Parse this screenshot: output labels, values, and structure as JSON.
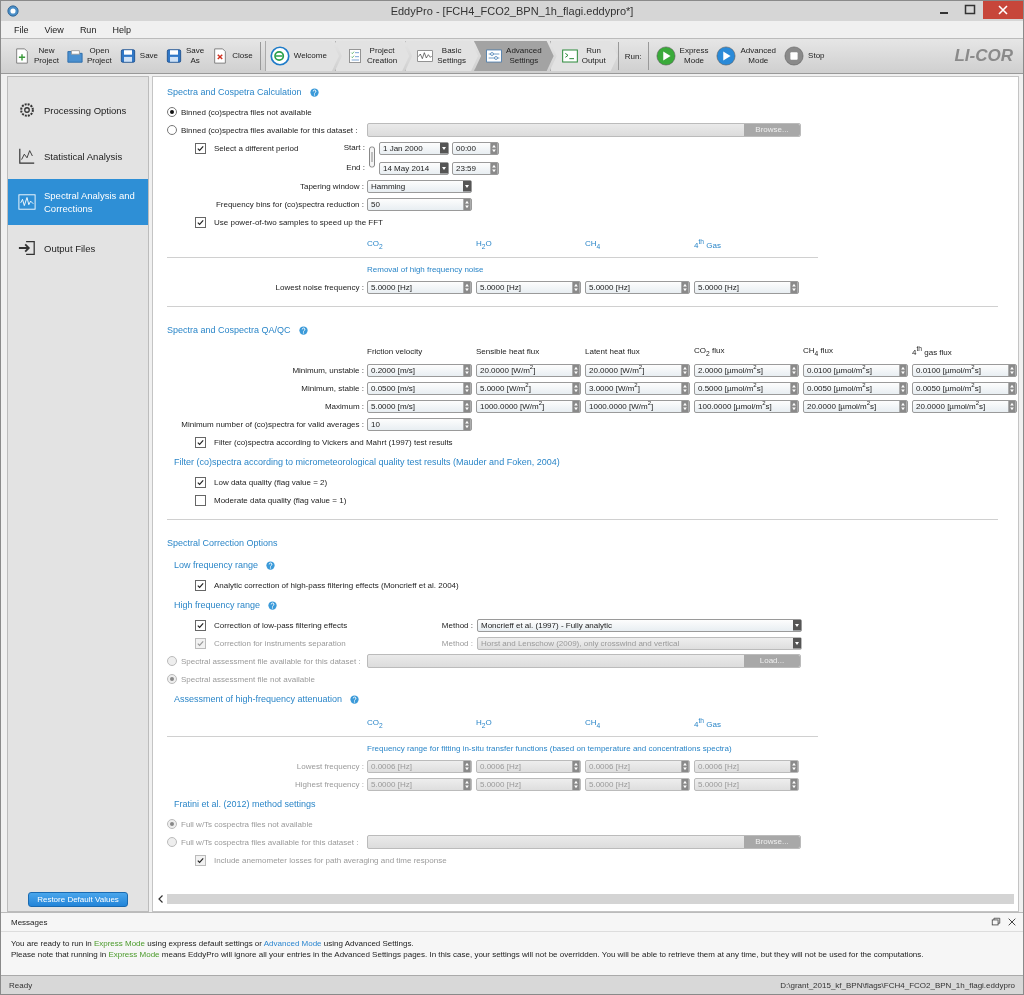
{
  "window": {
    "title": "EddyPro - [FCH4_FCO2_BPN_1h_flagi.eddypro*]"
  },
  "menu": [
    "File",
    "View",
    "Run",
    "Help"
  ],
  "toolbar": {
    "file_buttons": [
      "New Project",
      "Open Project",
      "Save",
      "Save As",
      "Close"
    ],
    "steps": [
      {
        "label": "Welcome",
        "selected": false
      },
      {
        "label": "Project Creation",
        "selected": false
      },
      {
        "label": "Basic Settings",
        "selected": false
      },
      {
        "label": "Advanced Settings",
        "selected": true
      },
      {
        "label": "Run Output",
        "selected": false
      }
    ],
    "run_label": "Run:",
    "run_buttons": [
      "Express Mode",
      "Advanced Mode",
      "Stop"
    ],
    "logo": "LI-COR"
  },
  "sidebar": {
    "items": [
      {
        "label": "Processing Options",
        "selected": false
      },
      {
        "label": "Statistical Analysis",
        "selected": false
      },
      {
        "label": "Spectral Analysis and Corrections",
        "selected": true
      },
      {
        "label": "Output Files",
        "selected": false
      }
    ],
    "restore_button": "Restore Default Values"
  },
  "content": [
    {
      "kind": "section",
      "text": "Spectra and Cospetra Calculation",
      "help": true
    },
    {
      "kind": "radio",
      "label": "Binned (co)spectra files not available",
      "selected": true,
      "disabled": false
    },
    {
      "kind": "radio",
      "label": "Binned (co)spectra files available for this dataset :",
      "selected": false,
      "disabled": false,
      "file_button": "Browse..."
    },
    {
      "kind": "period",
      "label": "Select a different period",
      "checked": true,
      "start_label": "Start :",
      "start_date": "1 Jan 2000",
      "start_time": "00:00",
      "end_label": "End :",
      "end_date": "14 May 2014",
      "end_time": "23:59"
    },
    {
      "kind": "field_row",
      "label": "Tapering window :",
      "disabled": false,
      "fields": [
        {
          "kind": "combo",
          "value": "Hamming"
        }
      ]
    },
    {
      "kind": "field_row",
      "label": "Frequency bins for (co)spectra reduction :",
      "disabled": false,
      "fields": [
        {
          "kind": "spin",
          "value": "50"
        }
      ]
    },
    {
      "kind": "checkbox",
      "label": "Use power-of-two samples to speed up the FFT",
      "checked": true,
      "disabled": false
    },
    {
      "kind": "gas_heads",
      "heads": [
        "CO$_{2}$",
        "H$_{2}$O",
        "CH$_{4}$",
        "4$^{th}$ Gas"
      ]
    },
    {
      "kind": "note",
      "text": "Removal of high frequency noise"
    },
    {
      "kind": "field_row",
      "label": "Lowest noise frequency :",
      "disabled": false,
      "fields": [
        {
          "kind": "spin",
          "value": "5.0000 [Hz]"
        },
        {
          "kind": "spin",
          "value": "5.0000 [Hz]"
        },
        {
          "kind": "spin",
          "value": "5.0000 [Hz]"
        },
        {
          "kind": "spin",
          "value": "5.0000 [Hz]"
        }
      ]
    },
    {
      "kind": "divider"
    },
    {
      "kind": "section",
      "text": "Spectra and Cospectra QA/QC",
      "help": true
    },
    {
      "kind": "column_heads",
      "heads": [
        "Friction velocity",
        "Sensible heat flux",
        "Latent heat flux",
        "CO$_{2}$ flux",
        "CH$_{4}$ flux",
        "4$^{th}$ gas flux"
      ]
    },
    {
      "kind": "field_row",
      "label": "Minimum, unstable :",
      "disabled": false,
      "fields": [
        {
          "kind": "spin",
          "value": "0.2000 [m/s]"
        },
        {
          "kind": "spin",
          "value": "20.0000 [W/m$^{2}$]"
        },
        {
          "kind": "spin",
          "value": "20.0000 [W/m$^{2}$]"
        },
        {
          "kind": "spin",
          "value": "2.0000 [µmol/m$^{2}$s]"
        },
        {
          "kind": "spin",
          "value": "0.0100 [µmol/m$^{2}$s]"
        },
        {
          "kind": "spin",
          "value": "0.0100 [µmol/m$^{2}$s]"
        }
      ]
    },
    {
      "kind": "field_row",
      "label": "Minimum, stable :",
      "disabled": false,
      "fields": [
        {
          "kind": "spin",
          "value": "0.0500 [m/s]"
        },
        {
          "kind": "spin",
          "value": "5.0000 [W/m$^{2}$]"
        },
        {
          "kind": "spin",
          "value": "3.0000 [W/m$^{2}$]"
        },
        {
          "kind": "spin",
          "value": "0.5000 [µmol/m$^{2}$s]"
        },
        {
          "kind": "spin",
          "value": "0.0050 [µmol/m$^{2}$s]"
        },
        {
          "kind": "spin",
          "value": "0.0050 [µmol/m$^{2}$s]"
        }
      ]
    },
    {
      "kind": "field_row",
      "label": "Maximum :",
      "disabled": false,
      "fields": [
        {
          "kind": "spin",
          "value": "5.0000 [m/s]"
        },
        {
          "kind": "spin",
          "value": "1000.0000 [W/m$^{2}$]"
        },
        {
          "kind": "spin",
          "value": "1000.0000 [W/m$^{2}$]"
        },
        {
          "kind": "spin",
          "value": "100.0000 [µmol/m$^{2}$s]"
        },
        {
          "kind": "spin",
          "value": "20.0000 [µmol/m$^{2}$s]"
        },
        {
          "kind": "spin",
          "value": "20.0000 [µmol/m$^{2}$s]"
        }
      ]
    },
    {
      "kind": "field_row",
      "label": "Minimum number of (co)spectra for valid averages :",
      "disabled": false,
      "fields": [
        {
          "kind": "spin",
          "value": "10"
        }
      ]
    },
    {
      "kind": "checkbox",
      "label": "Filter (co)spectra according to Vickers and Mahrt (1997) test results",
      "checked": true,
      "disabled": false
    },
    {
      "kind": "subsection",
      "text": "Filter (co)spectra according to micrometeorological quality test results (Mauder and Foken, 2004)",
      "help": false
    },
    {
      "kind": "checkbox",
      "label": "Low data quality (flag value = 2)",
      "checked": true,
      "disabled": false
    },
    {
      "kind": "checkbox",
      "label": "Moderate data quality (flag value = 1)",
      "checked": false,
      "disabled": false
    },
    {
      "kind": "divider"
    },
    {
      "kind": "section",
      "text": "Spectral Correction Options",
      "help": false
    },
    {
      "kind": "subsection",
      "text": "Low frequency range",
      "help": true
    },
    {
      "kind": "checkbox",
      "label": "Analytic correction of high-pass filtering effects (Moncrieff et al. 2004)",
      "checked": true,
      "disabled": false
    },
    {
      "kind": "subsection",
      "text": "High frequency range",
      "help": true
    },
    {
      "kind": "method",
      "label": "Correction of low-pass filtering effects",
      "checked": true,
      "disabled": false,
      "method_label": "Method :",
      "value": "Moncrieff et al. (1997) - Fully analytic"
    },
    {
      "kind": "method",
      "label": "Correction for instruments separation",
      "checked": true,
      "disabled": true,
      "method_label": "Method :",
      "value": "Horst and Lenschow (2009), only crosswind and vertical"
    },
    {
      "kind": "radio",
      "label": "Spectral assessment file available for this dataset :",
      "selected": false,
      "disabled": true,
      "file_button": "Load..."
    },
    {
      "kind": "radio",
      "label": "Spectral assessment file not available",
      "selected": true,
      "disabled": true
    },
    {
      "kind": "subsection",
      "text": "Assessment of high-frequency attenuation",
      "help": true
    },
    {
      "kind": "gas_heads",
      "heads": [
        "CO$_{2}$",
        "H$_{2}$O",
        "CH$_{4}$",
        "4$^{th}$ Gas"
      ]
    },
    {
      "kind": "note",
      "text": "Frequency range for fitting in-situ transfer functions (based on temperature and concentrations spectra)"
    },
    {
      "kind": "field_row",
      "label": "Lowest frequency :",
      "disabled": true,
      "fields": [
        {
          "kind": "spin",
          "value": "0.0006 [Hz]"
        },
        {
          "kind": "spin",
          "value": "0.0006 [Hz]"
        },
        {
          "kind": "spin",
          "value": "0.0006 [Hz]"
        },
        {
          "kind": "spin",
          "value": "0.0006 [Hz]"
        }
      ]
    },
    {
      "kind": "field_row",
      "label": "Highest frequency :",
      "disabled": true,
      "fields": [
        {
          "kind": "spin",
          "value": "5.0000 [Hz]"
        },
        {
          "kind": "spin",
          "value": "5.0000 [Hz]"
        },
        {
          "kind": "spin",
          "value": "5.0000 [Hz]"
        },
        {
          "kind": "spin",
          "value": "5.0000 [Hz]"
        }
      ]
    },
    {
      "kind": "subsection",
      "text": "Fratini et al. (2012) method settings",
      "help": false
    },
    {
      "kind": "radio",
      "label": "Full w/Ts cospectra files not available",
      "selected": true,
      "disabled": true
    },
    {
      "kind": "radio",
      "label": "Full w/Ts cospectra files available for this dataset :",
      "selected": false,
      "disabled": true,
      "file_button": "Browse..."
    },
    {
      "kind": "checkbox",
      "label": "Include anemometer losses for path averaging and time response",
      "checked": true,
      "disabled": true
    }
  ],
  "messages": {
    "title": "Messages",
    "lines": [
      [
        {
          "kind": "text",
          "text": "You are ready to run in "
        },
        {
          "kind": "express",
          "text": "Express Mode"
        },
        {
          "kind": "text",
          "text": " using express default settings or "
        },
        {
          "kind": "advanced",
          "text": "Advanced Mode"
        },
        {
          "kind": "text",
          "text": " using Advanced Settings."
        }
      ],
      [
        {
          "kind": "text",
          "text": "Please note that running in "
        },
        {
          "kind": "express",
          "text": "Express Mode"
        },
        {
          "kind": "text",
          "text": " means EddyPro will ignore all your entries in the Advanced Settings pages. In this case, your settings will not be overridden. You will be able to retrieve them at any time, but they will not be used for the computations."
        }
      ]
    ]
  },
  "status_bar": {
    "status": "Ready",
    "path": "D:\\grant_2015_kf_BPN\\flags\\FCH4_FCO2_BPN_1h_flagi.eddypro"
  }
}
